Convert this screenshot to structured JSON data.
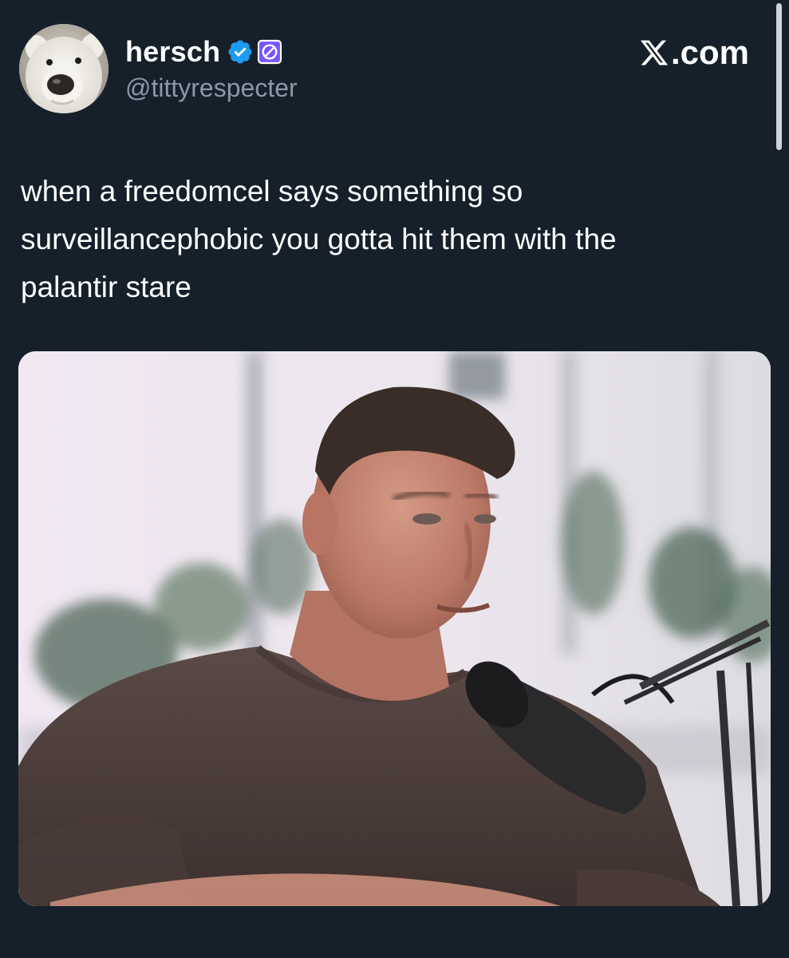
{
  "header": {
    "display_name": "hersch",
    "handle": "@tittyrespecter",
    "site_label": ".com",
    "avatar_icon": "polar-bear-avatar",
    "verified_icon": "verified-badge-icon",
    "affiliate_icon": "affiliate-badge-icon",
    "colors": {
      "verified": "#1d9bf0",
      "affiliate": "#7856ff"
    }
  },
  "tweet": {
    "text_lines": [
      "when a freedomcel says something so",
      "surveillancephobic you gotta hit them with the",
      "palantir stare"
    ]
  },
  "theme": {
    "background": "#15202b",
    "secondary_text": "#8b98a5"
  }
}
